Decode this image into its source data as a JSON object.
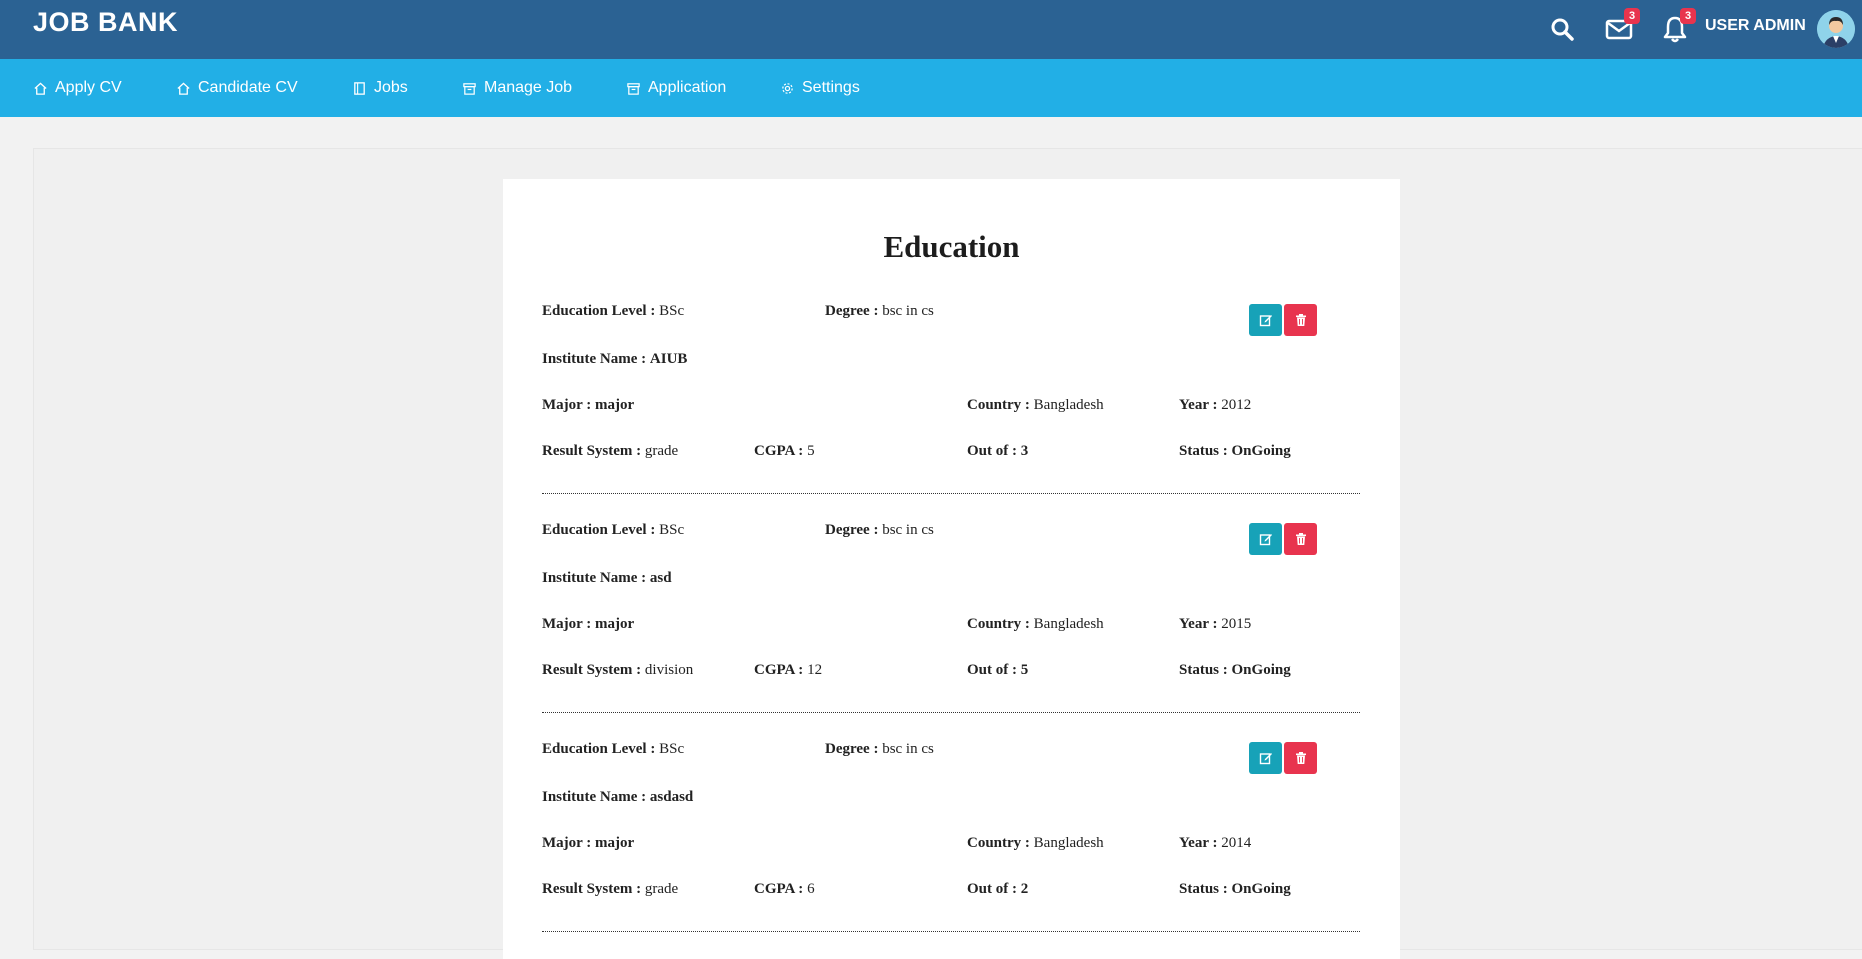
{
  "header": {
    "brand": "JOB BANK",
    "user_name": "USER ADMIN",
    "mail_count": "3",
    "notification_count": "3"
  },
  "nav": {
    "items": [
      {
        "label": "Apply CV",
        "icon": "home-icon"
      },
      {
        "label": "Candidate CV",
        "icon": "home-icon"
      },
      {
        "label": "Jobs",
        "icon": "book-icon"
      },
      {
        "label": "Manage Job",
        "icon": "archive-icon"
      },
      {
        "label": "Application",
        "icon": "archive-icon"
      },
      {
        "label": "Settings",
        "icon": "gear-icon"
      }
    ]
  },
  "section": {
    "title": "Education"
  },
  "labels": {
    "education_level": "Education Level :",
    "degree": "Degree :",
    "institute": "Institute Name :",
    "major": "Major :",
    "country": "Country :",
    "year": "Year :",
    "result_system": "Result System :",
    "cgpa": "CGPA :",
    "out_of": "Out of :",
    "status": "Status :"
  },
  "records": [
    {
      "education_level": "BSc",
      "degree": "bsc in cs",
      "institute": "AIUB",
      "major": "major",
      "country": "Bangladesh",
      "year": "2012",
      "result_system": "grade",
      "cgpa": "5",
      "out_of": "3",
      "status": "OnGoing"
    },
    {
      "education_level": "BSc",
      "degree": "bsc in cs",
      "institute": "asd",
      "major": "major",
      "country": "Bangladesh",
      "year": "2015",
      "result_system": "division",
      "cgpa": "12",
      "out_of": "5",
      "status": "OnGoing"
    },
    {
      "education_level": "BSc",
      "degree": "bsc in cs",
      "institute": "asdasd",
      "major": "major",
      "country": "Bangladesh",
      "year": "2014",
      "result_system": "grade",
      "cgpa": "6",
      "out_of": "2",
      "status": "OnGoing"
    }
  ],
  "colors": {
    "header_bg": "#2b6293",
    "nav_bg": "#22afe6",
    "edit_button": "#17a2b8",
    "delete_button": "#e8344e"
  }
}
